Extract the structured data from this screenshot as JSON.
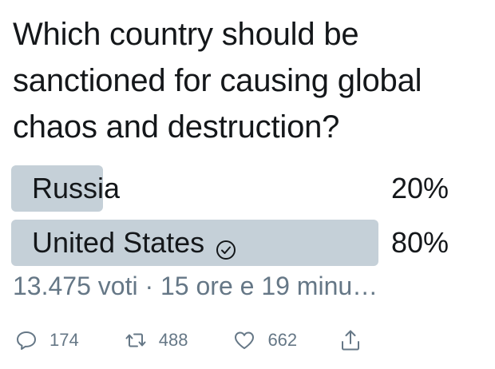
{
  "poll": {
    "question": "Which country should be sanctioned for causing global chaos and destruction?",
    "options": [
      {
        "label": "Russia",
        "percent_text": "20%",
        "percent": 20,
        "selected": false
      },
      {
        "label": "United States",
        "percent_text": "80%",
        "percent": 80,
        "selected": true
      }
    ],
    "meta": "13.475 voti · 15 ore e 19 minu…"
  },
  "actions": {
    "reply_count": "174",
    "retweet_count": "488",
    "like_count": "662"
  },
  "colors": {
    "bar": "#c5d0d8",
    "muted_text": "#657786",
    "text": "#14171a"
  },
  "icons": [
    "check-circle-icon",
    "reply-icon",
    "retweet-icon",
    "like-icon",
    "share-icon"
  ]
}
